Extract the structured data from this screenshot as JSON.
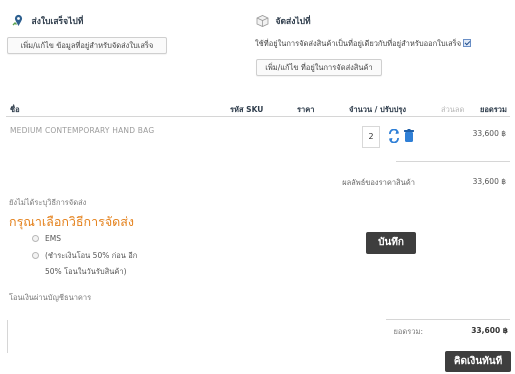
{
  "billing": {
    "title": "ส่งใบเสร็จไปที่",
    "edit_button": "เพิ่ม/แก้ไข ข้อมูลที่อยู่สำหรับจัดส่งใบเสร็จ",
    "icon": "map-pin-icon"
  },
  "shipping": {
    "title": "จัดส่งไปที่",
    "note": "ใช้ที่อยู่ในการจัดส่งสินค้าเป็นที่อยู่เดียวกับที่อยู่สำหรับออกใบเสร็จ",
    "same_address_checked": true,
    "edit_button": "เพิ่ม/แก้ไข ที่อยู่ในการจัดส่งสินค้า",
    "icon": "package-icon"
  },
  "table": {
    "headers": {
      "name": "ชื่อ",
      "sku": "รหัส SKU",
      "price": "ราคา",
      "qty": "จำนวน / ปรับปรุง",
      "discount": "ส่วนลด",
      "total": "ยอดรวม"
    },
    "rows": [
      {
        "name": "MEDIUM CONTEMPORARY HAND BAG",
        "sku": "",
        "price": "",
        "qty": "2",
        "discount": "",
        "total": "33,600 ฿"
      }
    ],
    "subtotal_label": "ผลลัพธ์ของราคาสินค้า",
    "subtotal_value": "33,600 ฿"
  },
  "shipping_method": {
    "not_selected_note": "ยังไม่ได้ระบุวิธีการจัดส่ง",
    "heading": "กรุณาเลือกวิธีการจัดส่ง",
    "options": [
      {
        "label": "EMS"
      },
      {
        "label": "(ชำระเงินโอน 50% ก่อน อีก"
      },
      {
        "label": "50% โอนในวันรับสินค้า)"
      }
    ],
    "save_button": "บันทึก"
  },
  "payment": {
    "method_label": "โอนเงินผ่านบัญชีธนาคาร"
  },
  "summary": {
    "grand_total_label": "ยอดรวม:",
    "grand_total_value": "33,600 ฿"
  },
  "checkout_button": "คิดเงินทันที",
  "colors": {
    "accent_orange": "#e4801a",
    "dark_button": "#3e3e3e",
    "title_text": "#2d3b4a",
    "refresh_icon": "#2f7fd6",
    "delete_icon": "#2f7fd6"
  }
}
